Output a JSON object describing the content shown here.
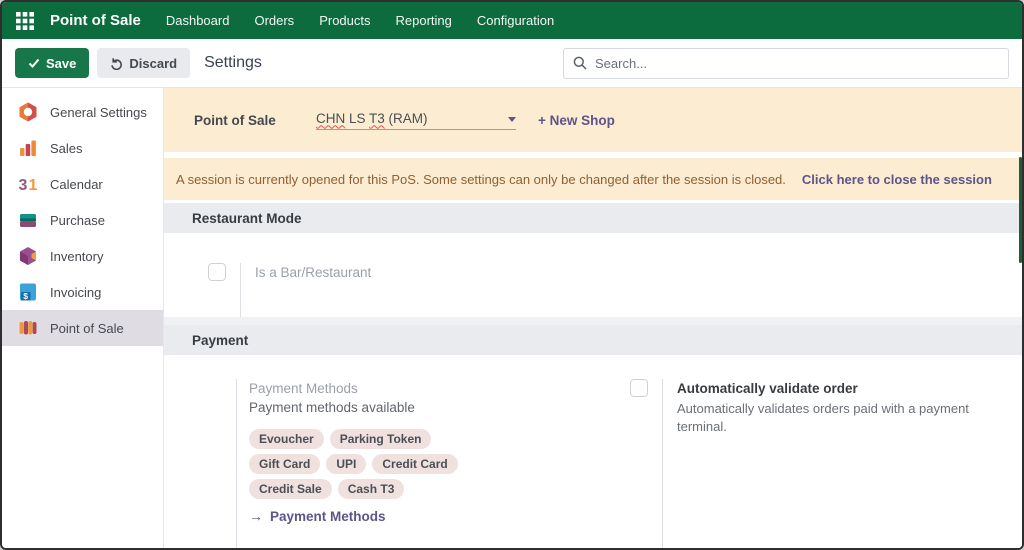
{
  "topbar": {
    "app_name": "Point of Sale",
    "menus": [
      "Dashboard",
      "Orders",
      "Products",
      "Reporting",
      "Configuration"
    ]
  },
  "control_bar": {
    "save_label": "Save",
    "discard_label": "Discard",
    "page_title": "Settings",
    "search_placeholder": "Search..."
  },
  "sidebar": {
    "selected": "Point of Sale",
    "items": [
      {
        "label": "General Settings"
      },
      {
        "label": "Sales"
      },
      {
        "label": "Calendar"
      },
      {
        "label": "Purchase"
      },
      {
        "label": "Inventory"
      },
      {
        "label": "Invoicing"
      },
      {
        "label": "Point of Sale"
      }
    ]
  },
  "shop_selector": {
    "label": "Point of Sale",
    "value": "CHN LS T3 (RAM)",
    "value_parts": [
      {
        "text": "CHN"
      },
      {
        "text": " LS "
      },
      {
        "text": "T3"
      },
      {
        "text": " (RAM)"
      }
    ],
    "new_shop_label": "+ New Shop"
  },
  "session_warning": {
    "message": "A session is currently opened for this PoS. Some settings can only be changed after the session is closed.",
    "link_label": "Click here to close the session"
  },
  "restaurant_section": {
    "title": "Restaurant Mode",
    "checkbox_label": "Is a Bar/Restaurant",
    "checked": false
  },
  "payment_section": {
    "title": "Payment",
    "field_label": "Payment Methods",
    "field_help": "Payment methods available",
    "tags": [
      "Evoucher",
      "Parking Token",
      "Gift Card",
      "UPI",
      "Credit Card",
      "Credit Sale",
      "Cash T3"
    ],
    "link_label": "Payment Methods",
    "auto_validate_title": "Automatically validate order",
    "auto_validate_desc": "Automatically validates orders paid with a payment terminal.",
    "auto_validate_checked": false
  },
  "colors": {
    "topbar_green": "#0c6c3e",
    "save_green": "#17764a",
    "accent_link": "#5e548b",
    "band_peach": "#fcecd2",
    "warning_text": "#8f5f33",
    "tag_bg": "#f0e1df",
    "sidebar_selected_bg": "#dfdce4"
  }
}
